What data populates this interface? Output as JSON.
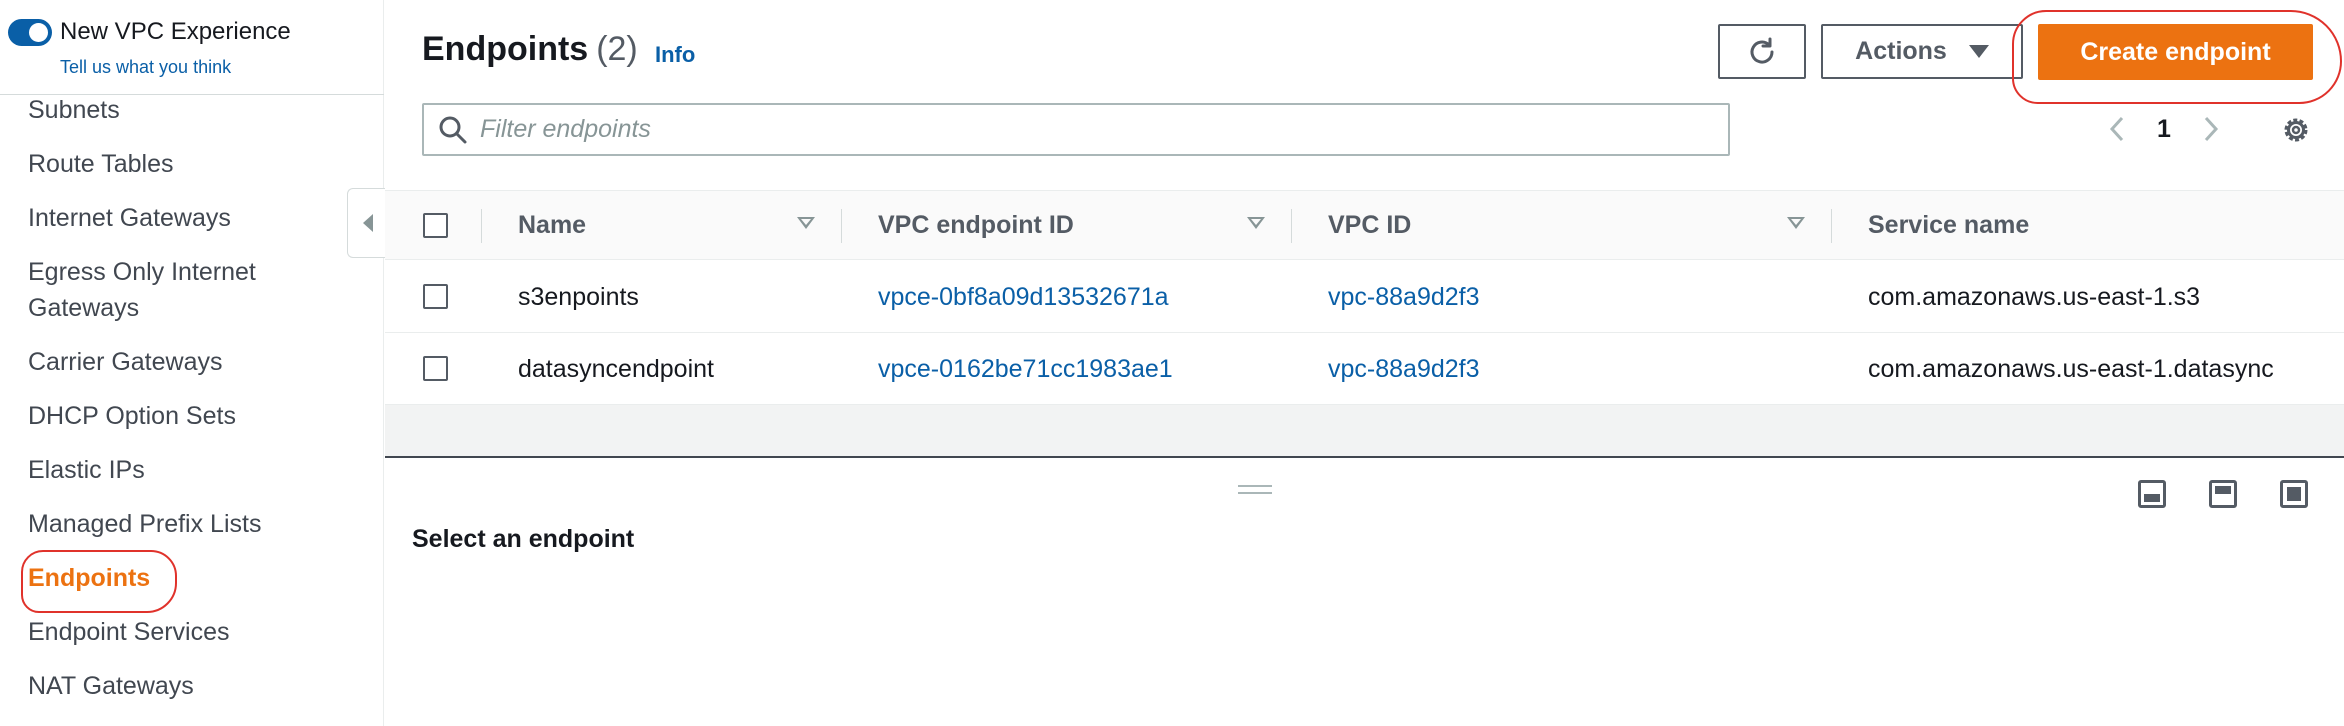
{
  "sidebar": {
    "toggle_label": "New VPC Experience",
    "feedback_link": "Tell us what you think",
    "items": [
      {
        "label": "Subnets"
      },
      {
        "label": "Route Tables"
      },
      {
        "label": "Internet Gateways"
      },
      {
        "label": "Egress Only Internet"
      },
      {
        "label": "Gateways"
      },
      {
        "label": "Carrier Gateways"
      },
      {
        "label": "DHCP Option Sets"
      },
      {
        "label": "Elastic IPs"
      },
      {
        "label": "Managed Prefix Lists"
      },
      {
        "label": "Endpoints",
        "active": true
      },
      {
        "label": "Endpoint Services"
      },
      {
        "label": "NAT Gateways"
      }
    ]
  },
  "header": {
    "title": "Endpoints",
    "count": "(2)",
    "info_link": "Info",
    "actions_label": "Actions",
    "create_label": "Create endpoint"
  },
  "filter": {
    "placeholder": "Filter endpoints"
  },
  "pagination": {
    "current_page": "1"
  },
  "table": {
    "columns": [
      "Name",
      "VPC endpoint ID",
      "VPC ID",
      "Service name"
    ],
    "rows": [
      {
        "name": "s3enpoints",
        "endpoint_id": "vpce-0bf8a09d13532671a",
        "vpc_id": "vpc-88a9d2f3",
        "service": "com.amazonaws.us-east-1.s3"
      },
      {
        "name": "datasyncendpoint",
        "endpoint_id": "vpce-0162be71cc1983ae1",
        "vpc_id": "vpc-88a9d2f3",
        "service": "com.amazonaws.us-east-1.datasync"
      }
    ]
  },
  "details": {
    "empty_message": "Select an endpoint"
  },
  "colors": {
    "accent": "#ec7211",
    "link": "#0a5fa7",
    "annotation": "#e0322b"
  }
}
